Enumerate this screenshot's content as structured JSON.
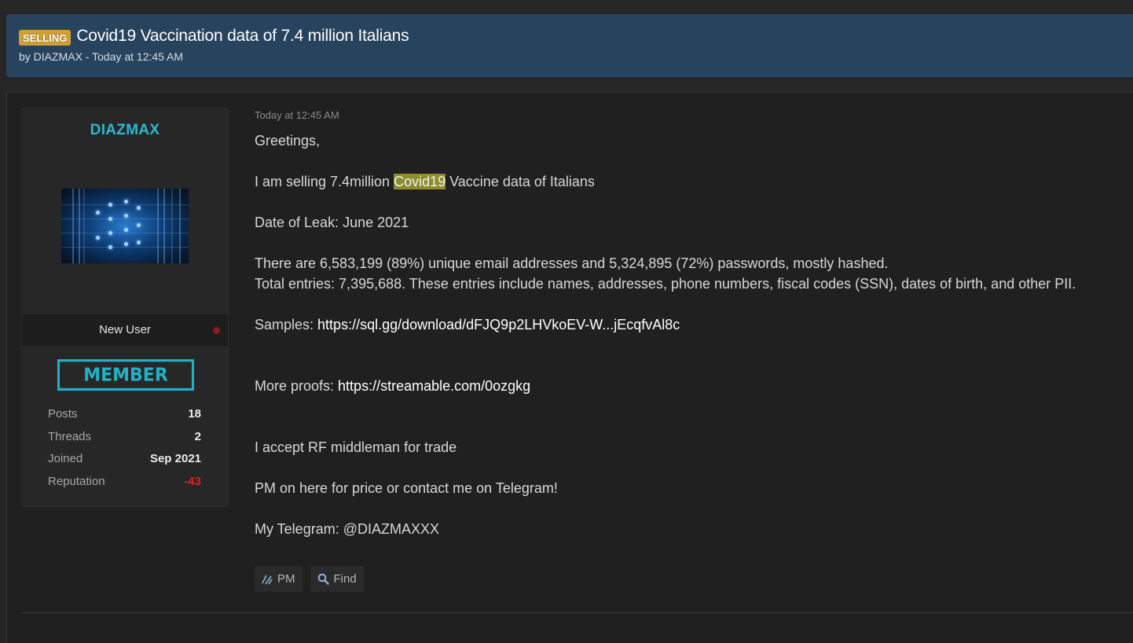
{
  "thread": {
    "prefix": "SELLING",
    "title": "Covid19 Vaccination data of 7.4 million Italians",
    "meta": "by DIAZMAX - Today at 12:45 AM"
  },
  "user": {
    "name": "DIAZMAX",
    "rank_title": "New User",
    "badge": "MEMBER",
    "stats": [
      {
        "label": "Posts",
        "value": "18"
      },
      {
        "label": "Threads",
        "value": "2"
      },
      {
        "label": "Joined",
        "value": "Sep 2021"
      },
      {
        "label": "Reputation",
        "value": "-43"
      }
    ]
  },
  "post": {
    "date": "Today at 12:45 AM",
    "greeting": "Greetings,",
    "line_selling_pre": "I am selling 7.4million ",
    "line_selling_highlight": "Covid19",
    "line_selling_post": " Vaccine data of Italians",
    "date_of_leak": "Date of Leak: June 2021",
    "stats_line": "There are 6,583,199 (89%) unique email addresses and 5,324,895 (72%) passwords, mostly hashed.",
    "entries_line": "Total entries: 7,395,688. These entries include names, addresses, phone numbers, fiscal codes (SSN), dates of birth, and other PII.",
    "samples_label": "Samples: ",
    "samples_link": "https://sql.gg/download/dFJQ9p2LHVkoEV-W...jEcqfvAl8c",
    "proofs_label": "More proofs: ",
    "proofs_link": "https://streamable.com/0ozgkg",
    "middleman": "I accept RF middleman for trade",
    "pm_line": "PM on here for price or contact me on Telegram!",
    "telegram": "My Telegram: @DIAZMAXXX"
  },
  "actions": {
    "pm_label": "PM",
    "find_label": "Find"
  },
  "colors": {
    "header_bg": "#27435e",
    "prefix_bg": "#d0a033",
    "username": "#2db8d0",
    "reputation_negative": "#e02020",
    "highlight": "#8f8c2e"
  }
}
